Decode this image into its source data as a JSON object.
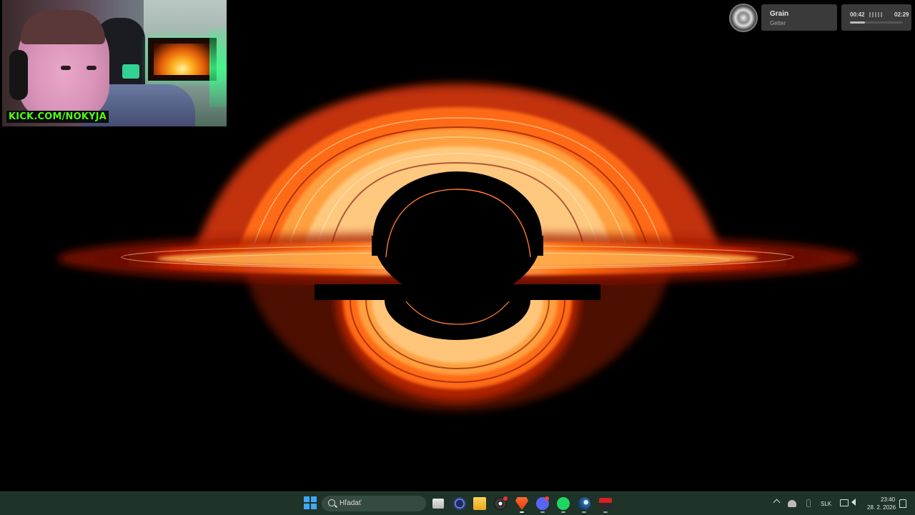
{
  "webcam": {
    "channel_text": "KICK.COM/NOKYJA"
  },
  "media": {
    "track_title": "Grain",
    "track_artist": "Getter",
    "elapsed": "00:42",
    "duration": "02:29",
    "progress_fraction": 0.29
  },
  "taskbar": {
    "search_placeholder": "Hľadať",
    "pinned_apps": [
      "task-view",
      "widget",
      "file-explorer",
      "obs",
      "brave",
      "discord",
      "spotify",
      "steam",
      "voicemeeter"
    ],
    "tray": {
      "language": "SLK",
      "time": "23:40",
      "date": "28. 2. 2026"
    }
  },
  "colors": {
    "taskbar_bg": "#1f3329",
    "kick_green": "#53fc18",
    "accent_orange": "#ff6a10"
  }
}
